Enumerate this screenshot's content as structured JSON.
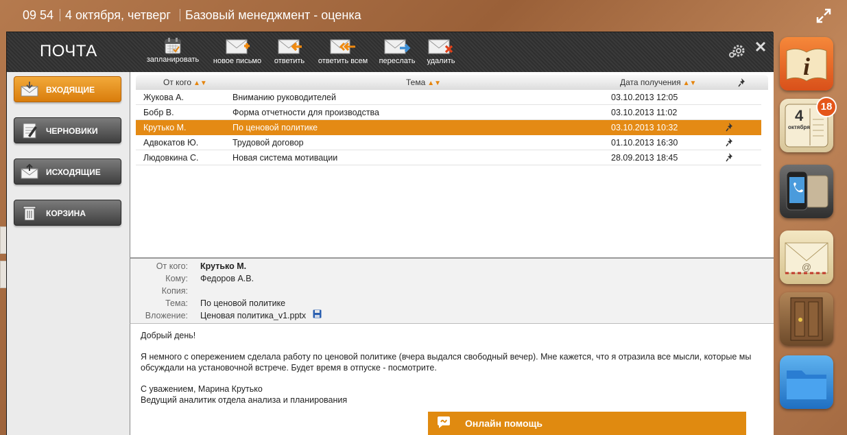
{
  "status_bar": {
    "time": "09 54",
    "date": "4 октября, четверг",
    "title": "Базовый менеджмент - оценка"
  },
  "mail": {
    "title": "ПОЧТА",
    "toolbar": {
      "schedule": "запланировать",
      "new_letter": "новое письмо",
      "reply": "ответить",
      "reply_all": "ответить всем",
      "forward": "переслать",
      "delete": "удалить"
    },
    "folders": [
      {
        "label": "ВХОДЯЩИЕ",
        "icon": "inbox-envelope-icon",
        "active": true
      },
      {
        "label": "ЧЕРНОВИКИ",
        "icon": "drafts-notepad-icon",
        "active": false
      },
      {
        "label": "ИСХОДЯЩИЕ",
        "icon": "outbox-envelope-icon",
        "active": false
      },
      {
        "label": "КОРЗИНА",
        "icon": "trash-icon",
        "active": false
      }
    ],
    "columns": {
      "from": "От кого",
      "subject": "Тема",
      "date": "Дата получения",
      "pin": "pin-icon"
    },
    "messages": [
      {
        "from": "Жукова А.",
        "subject": "Вниманию руководителей",
        "date": "03.10.2013 12:05",
        "pinned": false,
        "selected": false
      },
      {
        "from": "Бобр В.",
        "subject": "Форма отчетности для производства",
        "date": "03.10.2013 11:02",
        "pinned": false,
        "selected": false
      },
      {
        "from": "Крутько М.",
        "subject": "По ценовой политике",
        "date": "03.10.2013 10:32",
        "pinned": true,
        "selected": true
      },
      {
        "from": "Адвокатов Ю.",
        "subject": "Трудовой договор",
        "date": "01.10.2013 16:30",
        "pinned": true,
        "selected": false
      },
      {
        "from": "Людовкина С.",
        "subject": "Новая система мотивации",
        "date": "28.09.2013 18:45",
        "pinned": true,
        "selected": false
      }
    ],
    "preview": {
      "labels": {
        "from": "От кого:",
        "to": "Кому:",
        "cc": "Копия:",
        "subject": "Тема:",
        "attachment": "Вложение:"
      },
      "from": "Крутько М.",
      "to": "Федоров А.В.",
      "cc": "",
      "subject": "По ценовой политике",
      "attachment": "Ценовая политика_v1.pptx"
    },
    "body": {
      "greeting": "Добрый день!",
      "text": "Я немного с опережением сделала работу по ценовой политике (вчера выдался свободный вечер). Мне кажется, что я отразила все мысли, которые мы обсуждали на установочной встрече. Будет время в отпуске - посмотрите.",
      "sign_1": "С уважением, Марина Крутько",
      "sign_2": "Ведущий аналитик отдела анализа и планирования"
    }
  },
  "help": {
    "label": "Онлайн помощь"
  },
  "dock": {
    "apps": [
      "info-app-icon",
      "calendar-app-icon",
      "phone-app-icon",
      "mail-app-icon",
      "door-app-icon",
      "folder-app-icon"
    ],
    "calendar_day": "4",
    "calendar_month": "октября",
    "badge": "18"
  },
  "colors": {
    "accent": "#e48a14",
    "window": "#2e2e2e",
    "sidebar": "#ebebeb"
  }
}
